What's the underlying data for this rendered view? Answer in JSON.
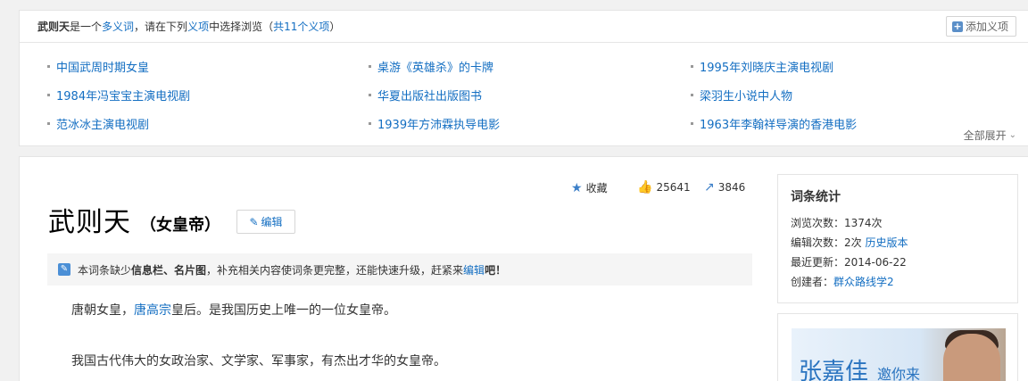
{
  "polysemy": {
    "term": "武则天",
    "text_a": "是一个",
    "link_polysemy": "多义词",
    "text_b": "，请在下列",
    "link_sense": "义项",
    "text_c": "中选择浏览（",
    "link_count": "共11个义项",
    "text_d": "）",
    "add_label": "添加义项",
    "expand_label": "全部展开",
    "items": [
      "中国武周时期女皇",
      "桌游《英雄杀》的卡牌",
      "1995年刘晓庆主演电视剧",
      "1984年冯宝宝主演电视剧",
      "华夏出版社出版图书",
      "梁羽生小说中人物",
      "范冰冰主演电视剧",
      "1939年方沛霖执导电影",
      "1963年李翰祥导演的香港电影"
    ]
  },
  "article": {
    "title": "武则天",
    "subtitle": "（女皇帝）",
    "edit_label": "编辑",
    "collect_label": "收藏",
    "like_count": "25641",
    "share_count": "3846",
    "notice": {
      "a": "本词条缺少",
      "b": "信息栏、名片图",
      "c": "，补充相关内容使词条更完整，还能快速升级，赶紧来",
      "link": "编辑",
      "d": "吧！"
    },
    "para1": {
      "a": "唐朝女皇，",
      "link": "唐高宗",
      "b": "皇后。是我国历史上唯一的一位女皇帝。"
    },
    "para2": "我国古代伟大的女政治家、文学家、军事家，有杰出才华的女皇帝。"
  },
  "stats": {
    "heading": "词条统计",
    "views_label": "浏览次数：",
    "views_value": "1374次",
    "edits_label": "编辑次数：",
    "edits_value": "2次",
    "history_link": "历史版本",
    "updated_label": "最近更新：",
    "updated_value": "2014-06-22",
    "creator_label": "创建者：",
    "creator_value": "群众路线学2"
  },
  "ad": {
    "name": "张嘉佳",
    "sub": "邀你来"
  },
  "colors": {
    "link": "#136ec2",
    "accent": "#3c7fc8"
  }
}
